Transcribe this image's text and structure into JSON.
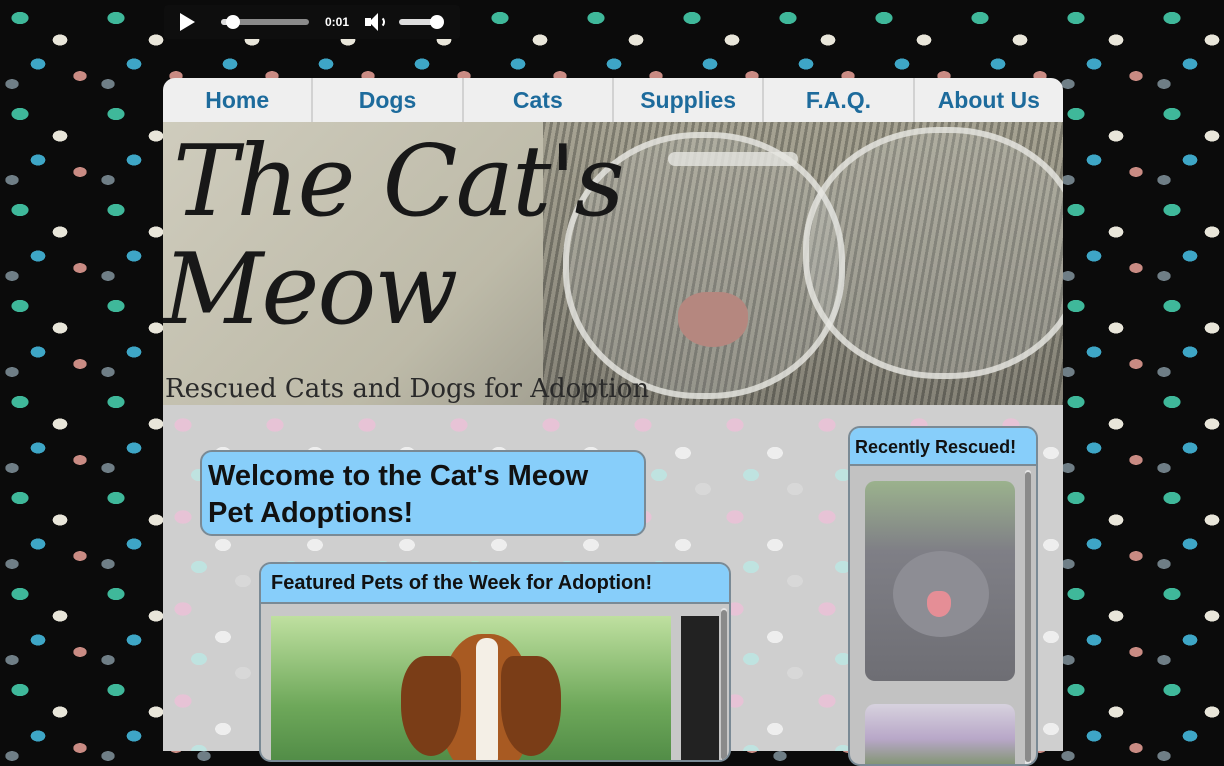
{
  "audio_player": {
    "time": "0:01",
    "progress_fraction": 0.1,
    "volume_fraction": 0.9
  },
  "nav": {
    "items": [
      "Home",
      "Dogs",
      "Cats",
      "Supplies",
      "F.A.Q.",
      "About Us"
    ]
  },
  "banner": {
    "title_line1": "The Cat's",
    "title_line2": "Meow",
    "tagline": "Rescued Cats and Dogs for Adoption"
  },
  "welcome": {
    "line1": "Welcome to the Cat's Meow",
    "line2": "Pet Adoptions!"
  },
  "featured": {
    "heading": "Featured Pets of the Week for Adoption!"
  },
  "sidebar": {
    "heading": "Recently Rescued!"
  },
  "colors": {
    "panel_header": "#87cefa",
    "nav_text": "#1d6b9c",
    "nav_bg": "#efefef"
  }
}
